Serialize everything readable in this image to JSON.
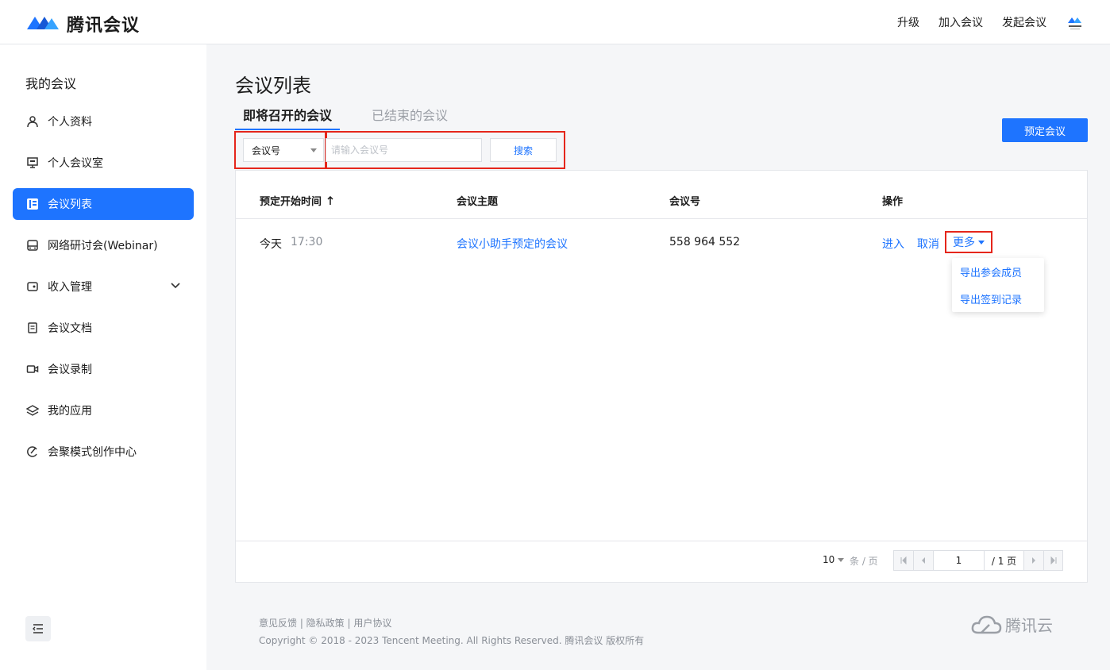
{
  "header": {
    "app_name": "腾讯会议",
    "nav": {
      "upgrade": "升级",
      "join": "加入会议",
      "start": "发起会议"
    }
  },
  "sidebar": {
    "title": "我的会议",
    "items": [
      {
        "label": "个人资料",
        "icon": "user-icon"
      },
      {
        "label": "个人会议室",
        "icon": "monitor-icon"
      },
      {
        "label": "会议列表",
        "icon": "list-icon",
        "active": true
      },
      {
        "label": "网络研讨会(Webinar)",
        "icon": "webinar-icon"
      },
      {
        "label": "收入管理",
        "icon": "wallet-icon",
        "expandable": true
      },
      {
        "label": "会议文档",
        "icon": "document-icon"
      },
      {
        "label": "会议录制",
        "icon": "video-icon"
      },
      {
        "label": "我的应用",
        "icon": "layers-icon"
      },
      {
        "label": "会聚模式创作中心",
        "icon": "create-icon"
      }
    ]
  },
  "main": {
    "title": "会议列表",
    "tabs": [
      "即将召开的会议",
      "已结束的会议"
    ],
    "book_button": "预定会议",
    "search": {
      "select_value": "会议号",
      "placeholder": "请输入会议号",
      "button": "搜索"
    },
    "table": {
      "columns": [
        "预定开始时间",
        "会议主题",
        "会议号",
        "操作"
      ],
      "rows": [
        {
          "day": "今天",
          "time": "17:30",
          "topic": "会议小助手预定的会议",
          "meeting_id": "558 964 552",
          "actions": {
            "enter": "进入",
            "cancel": "取消",
            "more": "更多"
          }
        }
      ],
      "more_menu": [
        "导出参会成员",
        "导出签到记录"
      ]
    },
    "pagination": {
      "page_size": "10",
      "per_page_label": "条 / 页",
      "current_page": "1",
      "total_label": "/ 1 页"
    }
  },
  "footer": {
    "links": "意见反馈 | 隐私政策 | 用户协议",
    "copyright": "Copyright © 2018 - 2023 Tencent Meeting. All Rights Reserved. 腾讯会议 版权所有",
    "cloud_brand": "腾讯云"
  },
  "colors": {
    "accent": "#1e74ff",
    "highlight": "#e5261b"
  }
}
